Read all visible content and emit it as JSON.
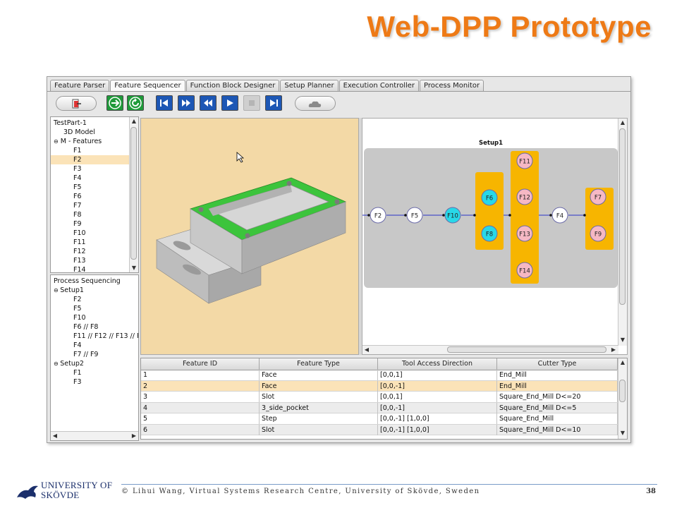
{
  "slide": {
    "title": "Web-DPP Prototype",
    "footer": "© Lihui Wang, Virtual Systems Research Centre, University of Skövde, Sweden",
    "page_number": "38",
    "logo_line1": "UNIVERSITY OF",
    "logo_line2": "SKÖVDE"
  },
  "tabs": [
    {
      "label": "Feature Parser",
      "active": false
    },
    {
      "label": "Feature Sequencer",
      "active": true
    },
    {
      "label": "Function Block Designer",
      "active": false
    },
    {
      "label": "Setup Planner",
      "active": false
    },
    {
      "label": "Execution Controller",
      "active": false
    },
    {
      "label": "Process Monitor",
      "active": false
    }
  ],
  "toolbar": {
    "icons": [
      "exit-icon",
      "forward-arrow-icon",
      "refresh-icon",
      "skip-to-start-icon",
      "fast-forward-icon",
      "rewind-icon",
      "play-icon",
      "stop-icon",
      "skip-to-end-icon",
      "cloud-icon"
    ]
  },
  "feature_tree": {
    "root": "TestPart-1",
    "model": "3D Model",
    "group": "M - Features",
    "items": [
      "F1",
      "F2",
      "F3",
      "F4",
      "F5",
      "F6",
      "F7",
      "F8",
      "F9",
      "F10",
      "F11",
      "F12",
      "F13",
      "F14"
    ],
    "selected": "F2"
  },
  "process_tree": {
    "root": "Process Sequencing",
    "setups": [
      {
        "label": "Setup1",
        "items": [
          "F2",
          "F5",
          "F10",
          "F6 // F8",
          "F11 // F12 // F13 // F",
          "F4",
          "F7 // F9"
        ]
      },
      {
        "label": "Setup2",
        "items": [
          "F1",
          "F3"
        ]
      }
    ]
  },
  "graph": {
    "title": "Setup1",
    "colors": {
      "background": "#c8c8c8",
      "group": "#f7b500",
      "cyan": "#28d8e8",
      "pink": "#f6b8c4",
      "white": "#ffffff",
      "edge": "#2a34c8"
    }
  },
  "table": {
    "columns": [
      "Feature ID",
      "Feature Type",
      "Tool Access Direction",
      "Cutter Type"
    ],
    "rows": [
      [
        "1",
        "Face",
        "[0,0,1]",
        "End_Mill"
      ],
      [
        "2",
        "Face",
        "[0,0,-1]",
        "End_Mill"
      ],
      [
        "3",
        "Slot",
        "[0,0,1]",
        "Square_End_Mill D<=20"
      ],
      [
        "4",
        "3_side_pocket",
        "[0,0,-1]",
        "Square_End_Mill D<=5"
      ],
      [
        "5",
        "Step",
        "[0,0,-1]  [1,0,0]",
        "Square_End_Mill"
      ],
      [
        "6",
        "Slot",
        "[0,0,-1]  [1,0,0]",
        "Square_End_Mill D<=10"
      ]
    ],
    "selected_row": 1
  },
  "colors": {
    "title": "#ee7a16",
    "selection": "#fbe3b8",
    "view3d_bg": "#f3d9a6",
    "part_face": "#3cc43c",
    "part_body": "#bfbfbf"
  }
}
